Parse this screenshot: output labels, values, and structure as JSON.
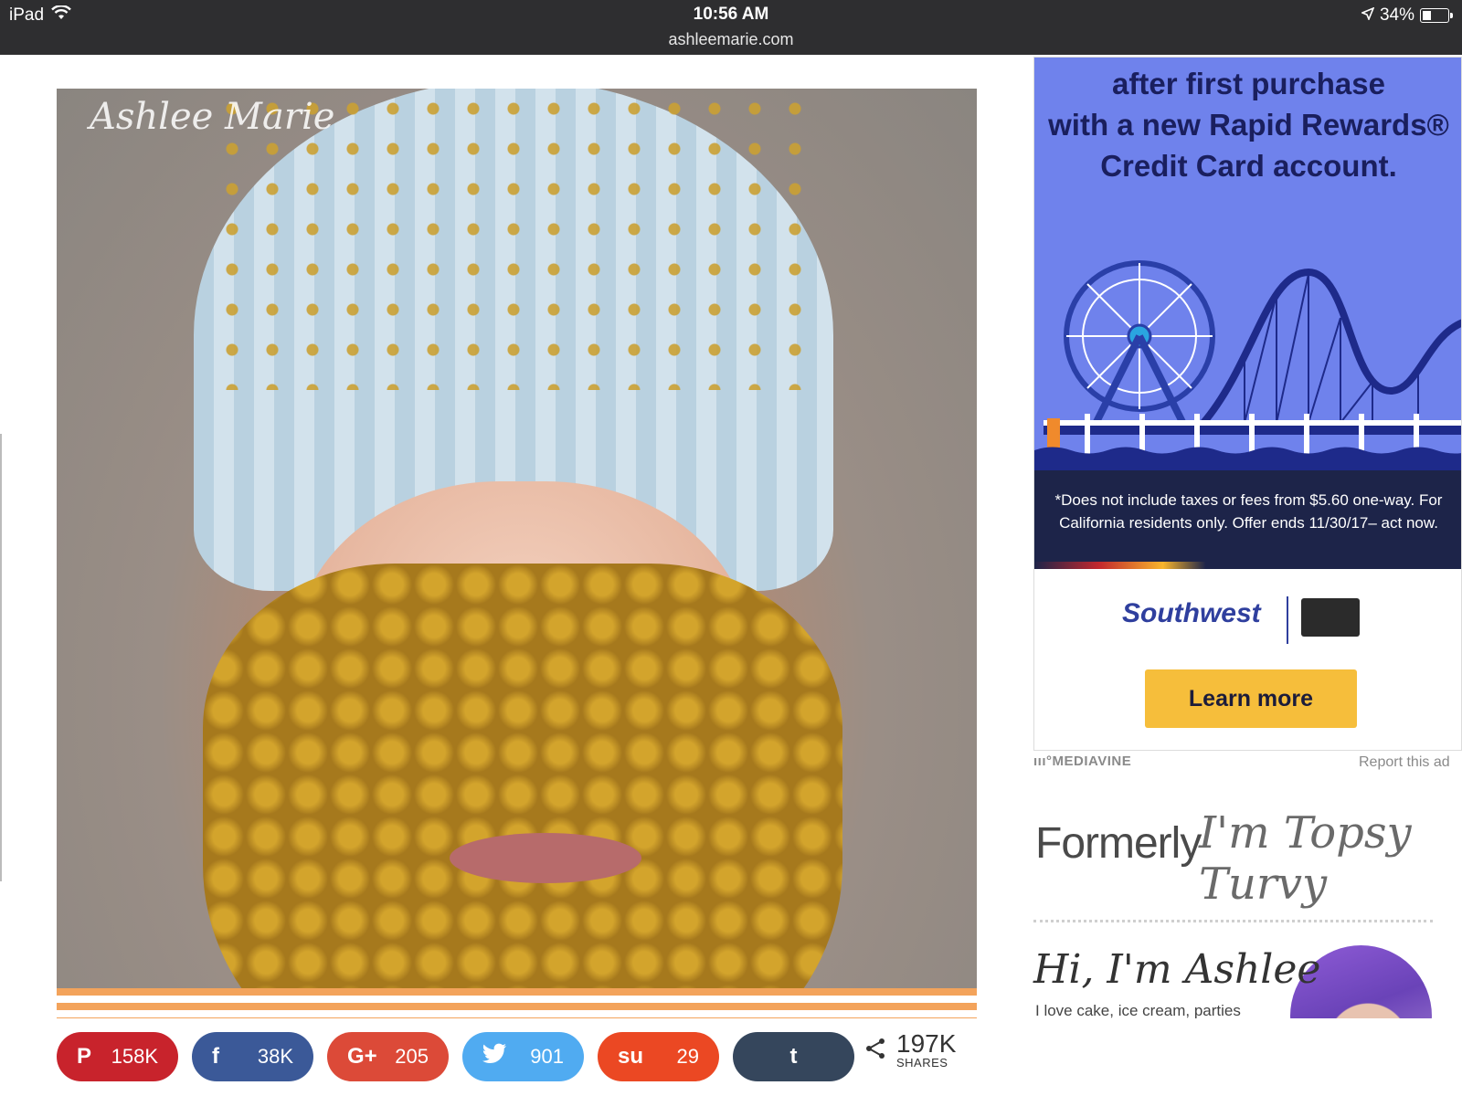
{
  "status_bar": {
    "device": "iPad",
    "time": "10:56 AM",
    "url": "ashleemarie.com",
    "battery": "34%",
    "battery_level": 0.34
  },
  "hero": {
    "watermark": "Ashlee Marie"
  },
  "share": {
    "buttons": [
      {
        "network": "pinterest",
        "icon": "P",
        "count": "158K",
        "color": "#c8232c"
      },
      {
        "network": "facebook",
        "icon": "f",
        "count": "38K",
        "color": "#3b5998"
      },
      {
        "network": "google-plus",
        "icon": "G+",
        "count": "205",
        "color": "#dc4a38"
      },
      {
        "network": "twitter",
        "icon": "🐦",
        "count": "901",
        "color": "#50abf1"
      },
      {
        "network": "stumbleupon",
        "icon": "su",
        "count": "29",
        "color": "#eb4823"
      },
      {
        "network": "tumblr",
        "icon": "t",
        "count": "",
        "color": "#35465c"
      }
    ],
    "total": "197K",
    "total_label": "SHARES"
  },
  "ad": {
    "headline_lines": [
      "after first purchase",
      "with a new Rapid Rewards®",
      "Credit Card account."
    ],
    "disclaimer": "*Does not include taxes or fees from $5.60 one-way. For California residents only. Offer ends 11/30/17– act now.",
    "brand": "Southwest",
    "cta": "Learn more",
    "network": "MEDIAVINE",
    "report": "Report this ad"
  },
  "sidebar": {
    "formerly": "Formerly",
    "old_name": "I'm Topsy Turvy",
    "greeting": "Hi, I'm Ashlee",
    "intro": "I love cake, ice cream, parties"
  }
}
